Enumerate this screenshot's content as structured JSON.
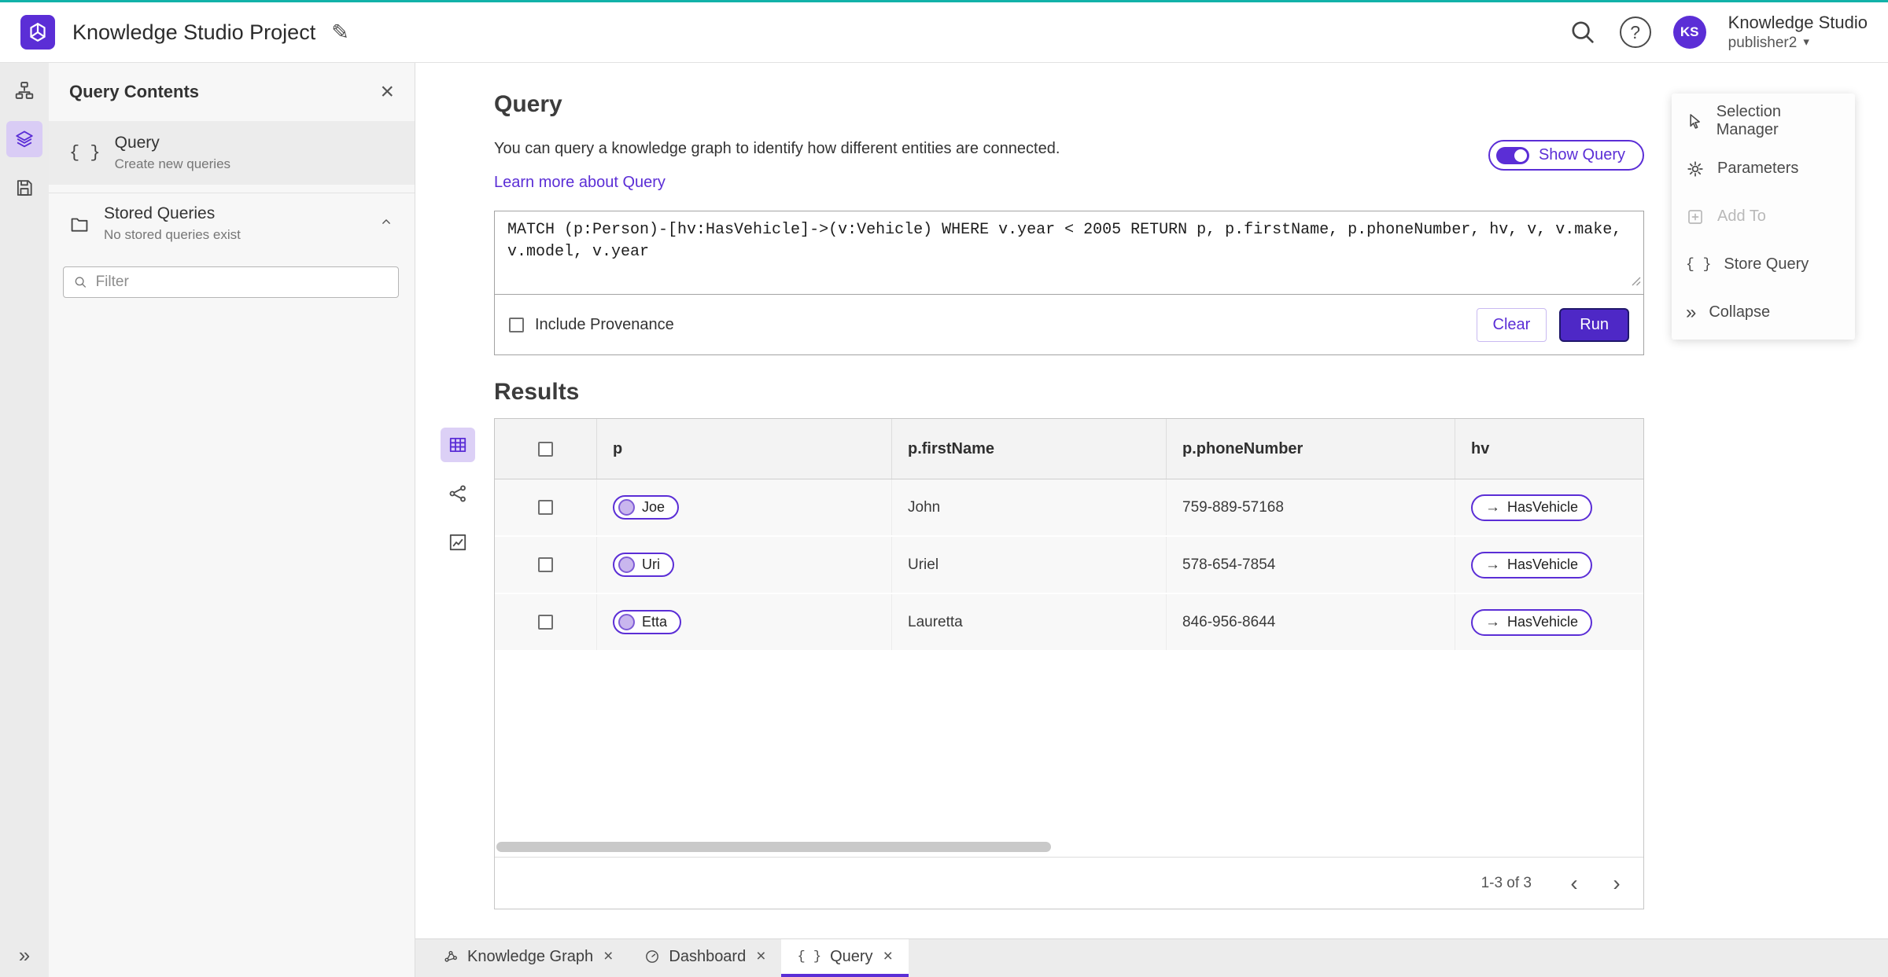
{
  "colors": {
    "accent": "#5b2ed6",
    "accent_dark": "#4e28c6",
    "top_stripe": "#12b2a9"
  },
  "icons": {
    "edit": "✎",
    "close": "×",
    "question": "?",
    "chevron_down": "▾",
    "braces": "{ }",
    "arrow_right": "→",
    "collapse": "»",
    "expand": "»",
    "chevron_left": "‹",
    "chevron_right": "›"
  },
  "header": {
    "app_title": "Knowledge Studio Project",
    "product_name": "Knowledge Studio",
    "user_name": "publisher2",
    "avatar_initials": "KS"
  },
  "sidebar": {
    "title": "Query Contents",
    "query_item": {
      "label": "Query",
      "description": "Create new queries"
    },
    "stored_section": {
      "label": "Stored Queries",
      "empty_text": "No stored queries exist"
    },
    "filter": {
      "placeholder": "Filter"
    }
  },
  "query_section": {
    "title": "Query",
    "description": "You can query a knowledge graph to identify how different entities are connected.",
    "learn_more": "Learn more about Query",
    "show_query": "Show Query",
    "query_text": "MATCH (p:Person)-[hv:HasVehicle]->(v:Vehicle) WHERE v.year < 2005 RETURN p, p.firstName, p.phoneNumber, hv, v, v.make, v.model, v.year",
    "include_provenance": "Include Provenance",
    "clear": "Clear",
    "run": "Run"
  },
  "results": {
    "title": "Results",
    "columns": [
      "p",
      "p.firstName",
      "p.phoneNumber",
      "hv"
    ],
    "rows": [
      {
        "p": "Joe",
        "firstName": "John",
        "phone": "759-889-57168",
        "hv": "HasVehicle"
      },
      {
        "p": "Uri",
        "firstName": "Uriel",
        "phone": "578-654-7854",
        "hv": "HasVehicle"
      },
      {
        "p": "Etta",
        "firstName": "Lauretta",
        "phone": "846-956-8644",
        "hv": "HasVehicle"
      }
    ],
    "pagination": "1-3 of 3"
  },
  "context_menu": {
    "items": [
      {
        "label": "Selection Manager"
      },
      {
        "label": "Parameters"
      },
      {
        "label": "Add To"
      },
      {
        "label": "Store Query"
      },
      {
        "label": "Collapse"
      }
    ]
  },
  "tabs": [
    {
      "label": "Knowledge Graph"
    },
    {
      "label": "Dashboard"
    },
    {
      "label": "Query"
    }
  ]
}
